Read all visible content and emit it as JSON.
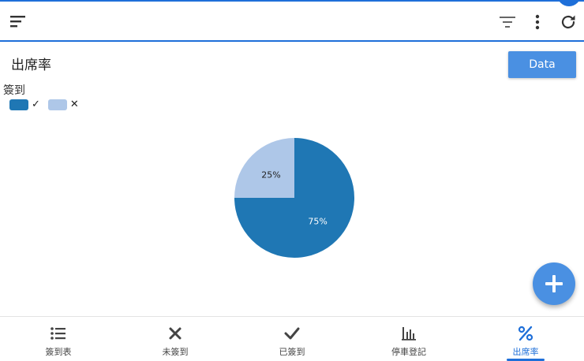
{
  "page": {
    "title": "出席率"
  },
  "toolbar": {
    "data_label": "Data"
  },
  "legend": {
    "title": "簽到",
    "items": [
      {
        "label": "✓",
        "color": "#1f77b4"
      },
      {
        "label": "✕",
        "color": "#aec7e8"
      }
    ]
  },
  "chart_data": {
    "type": "pie",
    "title": "",
    "legend_title": "簽到",
    "legend_position": "top-left",
    "categories": [
      "✓",
      "✕"
    ],
    "values": [
      75,
      25
    ],
    "labels": [
      "75%",
      "25%"
    ],
    "colors": [
      "#1f77b4",
      "#aec7e8"
    ]
  },
  "bottom_nav": {
    "items": [
      {
        "label": "簽到表",
        "icon": "list-icon"
      },
      {
        "label": "未簽到",
        "icon": "close-icon"
      },
      {
        "label": "已簽到",
        "icon": "check-icon"
      },
      {
        "label": "停車登記",
        "icon": "bar-chart-icon"
      },
      {
        "label": "出席率",
        "icon": "percent-icon"
      }
    ],
    "active_index": 4
  },
  "colors": {
    "accent": "#1e6fd9",
    "button": "#4a90e2"
  }
}
